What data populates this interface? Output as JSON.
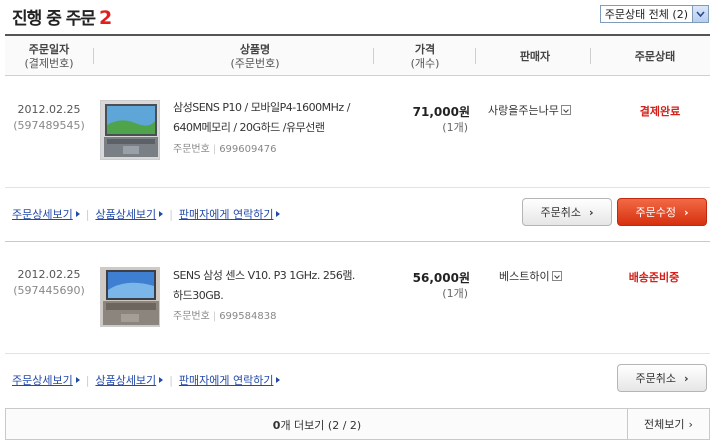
{
  "header": {
    "title": "진행 중 주문",
    "count": "2",
    "filter_value": "주문상태 전체 (2)"
  },
  "table_header": {
    "col_date": "주문일자",
    "col_date_sub": "(결제번호)",
    "col_product": "상품명",
    "col_product_sub": "(주문번호)",
    "col_price": "가격",
    "col_price_sub": "(개수)",
    "col_seller": "판매자",
    "col_status": "주문상태"
  },
  "orders": [
    {
      "date": "2012.02.25",
      "payment_no": "(597489545)",
      "product_line1": "삼성SENS P10 / 모바일P4-1600MHz /",
      "product_line2": "640M메모리 / 20G하드 /유무선랜",
      "order_no_label": "주문번호",
      "order_no": "699609476",
      "price": "71,000원",
      "qty": "(1개)",
      "seller": "사랑을주는나무",
      "status": "결제완료",
      "links": [
        "주문상세보기",
        "상품상세보기",
        "판매자에게 연락하기"
      ],
      "btn_cancel": "주문취소",
      "btn_modify": "주문수정"
    },
    {
      "date": "2012.02.25",
      "payment_no": "(597445690)",
      "product_line1": "SENS 삼성 센스 V10. P3 1GHz. 256램.",
      "product_line2": "하드30GB.",
      "order_no_label": "주문번호",
      "order_no": "699584838",
      "price": "56,000원",
      "qty": "(1개)",
      "seller": "베스트하이",
      "status": "배송준비중",
      "links": [
        "주문상세보기",
        "상품상세보기",
        "판매자에게 연락하기"
      ],
      "btn_cancel": "주문취소"
    }
  ],
  "footer": {
    "more_count": "0",
    "more_label": "개 더보기 (2 / 2)",
    "view_all": "전체보기"
  },
  "colors": {
    "accent_red": "#d3201a",
    "link_blue": "#2349a8",
    "button_red": "#e0401c"
  }
}
